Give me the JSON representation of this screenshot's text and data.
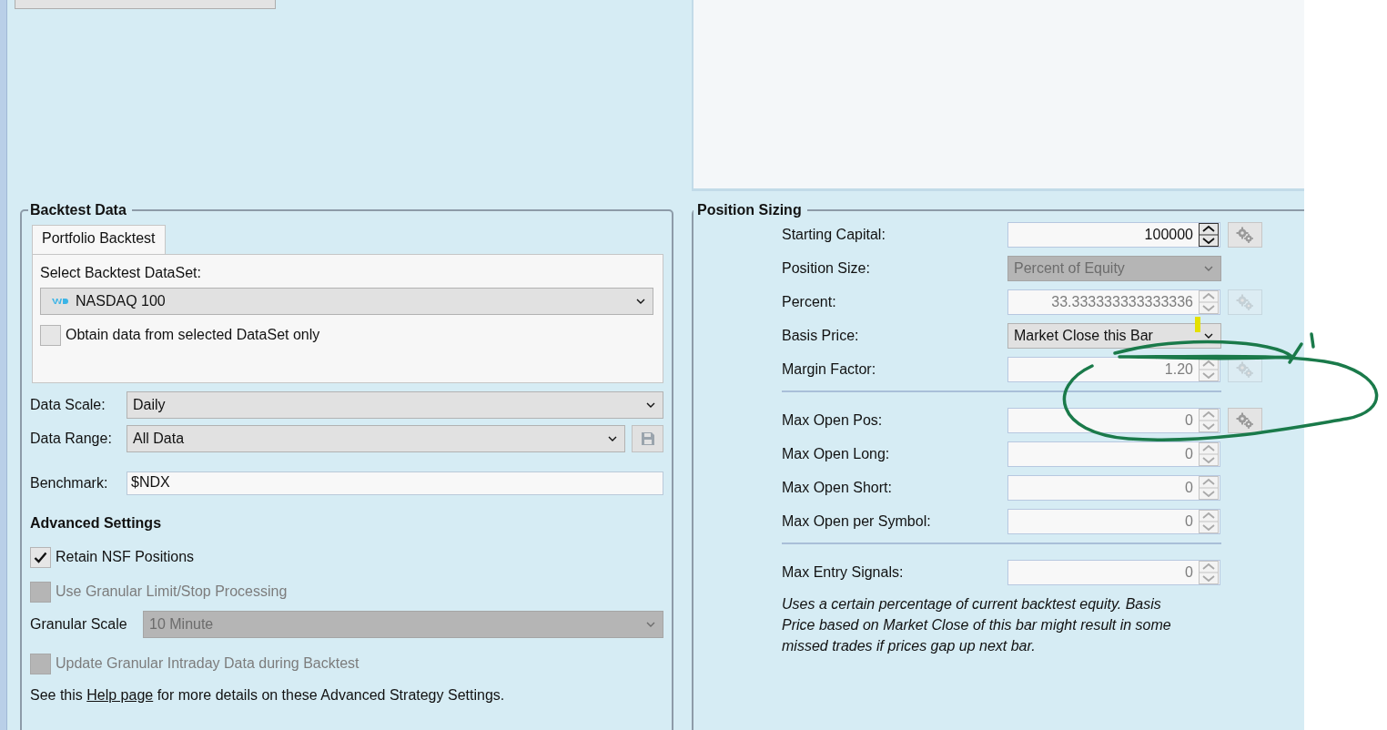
{
  "backtest_data": {
    "title": "Backtest Data",
    "tabs": [
      {
        "label": "Portfolio Backtest",
        "selected": true
      }
    ],
    "dataset_label": "Select Backtest DataSet:",
    "dataset": "NASDAQ 100",
    "dataset_only": {
      "label": "Obtain data from selected DataSet only",
      "checked": false
    },
    "fields": [
      {
        "kind": "combo",
        "label": "Data Scale:",
        "value": "Daily"
      },
      {
        "kind": "combo-save",
        "label": "Data Range:",
        "value": "All Data"
      },
      {
        "kind": "text",
        "label": "Benchmark:",
        "value": "$NDX"
      }
    ],
    "advanced": {
      "title": "Advanced Settings",
      "options": [
        {
          "kind": "checkbox",
          "label": "Retain NSF Positions",
          "checked": true,
          "disabled": false
        },
        {
          "kind": "checkbox",
          "label": "Use Granular Limit/Stop Processing",
          "checked": false,
          "disabled": true
        },
        {
          "kind": "combo",
          "label": "Granular Scale",
          "value": "10 Minute",
          "disabled": true
        },
        {
          "kind": "checkbox",
          "label": "Update Granular Intraday Data during Backtest",
          "checked": false,
          "disabled": true
        }
      ]
    },
    "help": {
      "before": "See this ",
      "link": "Help page",
      "after": " for more details on these Advanced Strategy Settings."
    }
  },
  "position_sizing": {
    "title": "Position Sizing",
    "rows": [
      {
        "kind": "spin",
        "label": "Starting Capital:",
        "value": "100000",
        "disabled": false,
        "gear": {
          "disabled": false
        }
      },
      {
        "kind": "combo",
        "label": "Position Size:",
        "value": "Percent of Equity",
        "disabled": true
      },
      {
        "kind": "spin",
        "label": "Percent:",
        "value": "33.333333333333336",
        "disabled": true,
        "gear": {
          "disabled": true
        }
      },
      {
        "kind": "combo",
        "label": "Basis Price:",
        "value": "Market Close this Bar",
        "disabled": false
      },
      {
        "kind": "spin",
        "label": "Margin Factor:",
        "value": "1.20",
        "disabled": true,
        "gear": {
          "disabled": true
        }
      },
      {
        "kind": "divider"
      },
      {
        "kind": "spin",
        "label": "Max Open Pos:",
        "value": "0",
        "disabled": true,
        "gear": {
          "disabled": false
        }
      },
      {
        "kind": "spin",
        "label": "Max Open Long:",
        "value": "0",
        "disabled": true
      },
      {
        "kind": "spin",
        "label": "Max Open Short:",
        "value": "0",
        "disabled": true
      },
      {
        "kind": "spin",
        "label": "Max Open per Symbol:",
        "value": "0",
        "disabled": true
      },
      {
        "kind": "divider"
      },
      {
        "kind": "spin",
        "label": "Max Entry Signals:",
        "value": "0",
        "disabled": true
      }
    ],
    "note": "Uses a certain percentage of current backtest equity. Basis Price based on Market Close of this bar might result in some missed trades if prices gap up next bar."
  }
}
